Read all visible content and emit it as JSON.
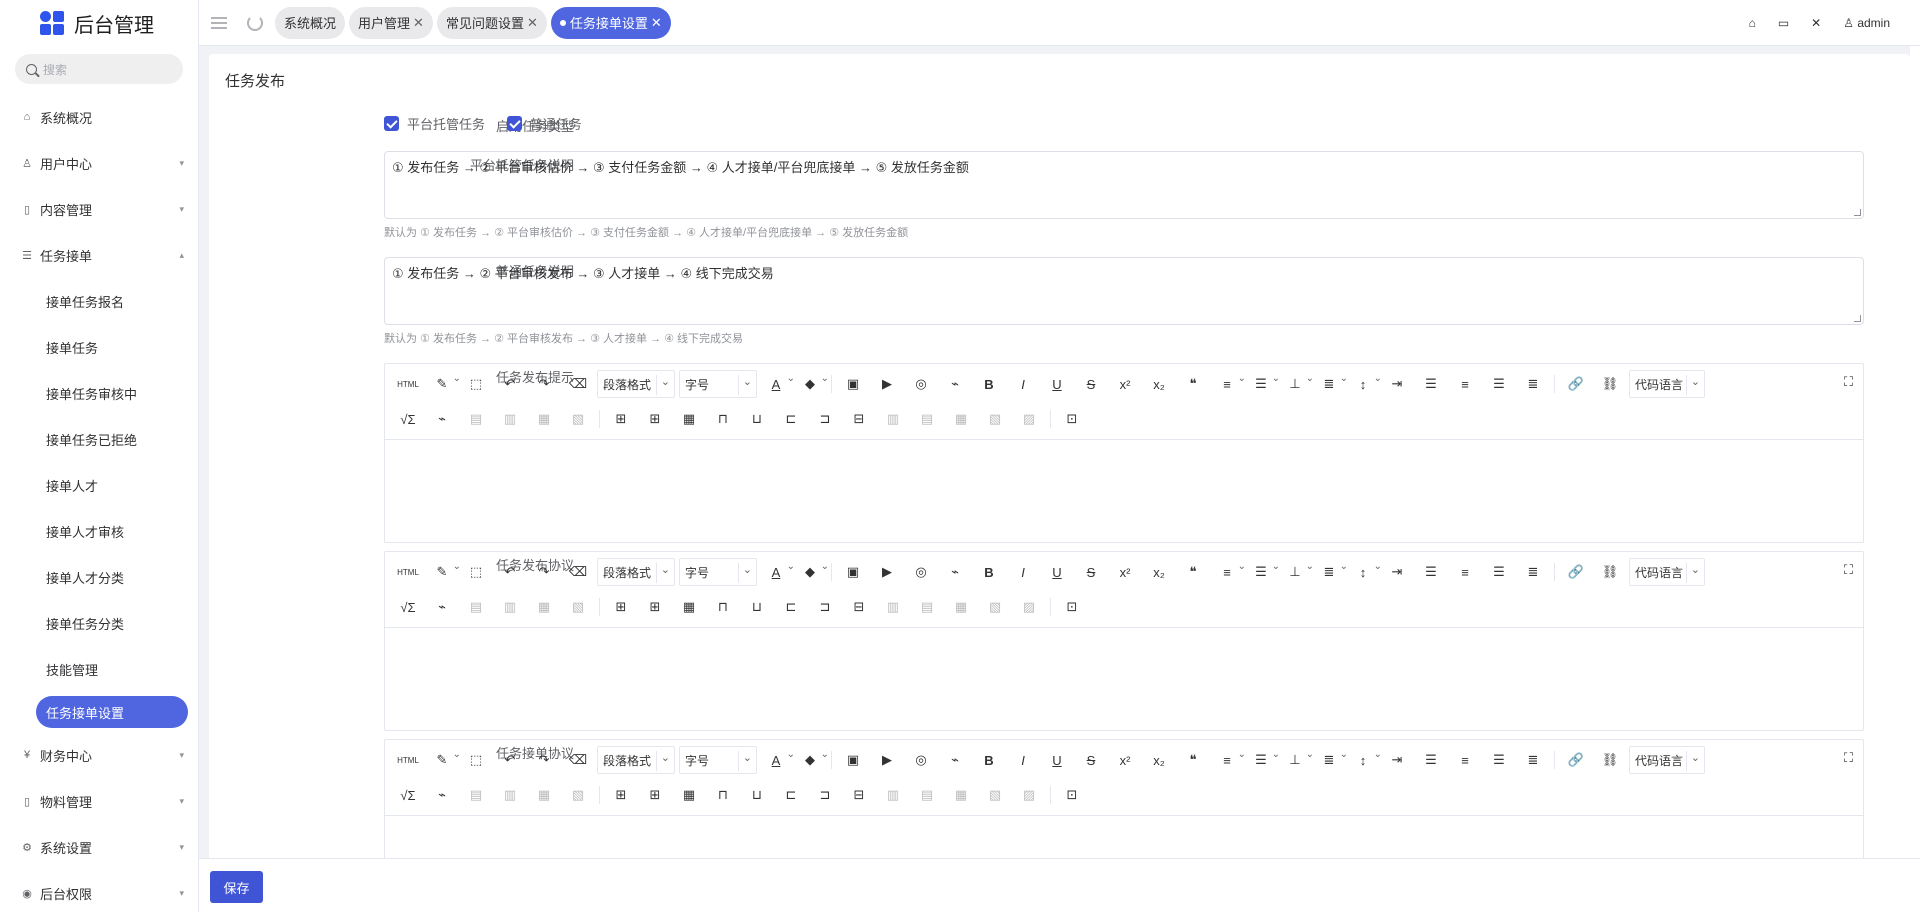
{
  "app": {
    "title": "后台管理"
  },
  "search": {
    "placeholder": "搜索"
  },
  "sidebar": {
    "items": [
      {
        "label": "系统概况",
        "icon": "home-icon"
      },
      {
        "label": "用户中心",
        "icon": "users-icon"
      },
      {
        "label": "内容管理",
        "icon": "document-icon"
      },
      {
        "label": "任务接单",
        "icon": "list-icon"
      },
      {
        "label": "财务中心",
        "icon": "yen-icon"
      },
      {
        "label": "物料管理",
        "icon": "document-icon"
      },
      {
        "label": "系统设置",
        "icon": "gear-icon"
      },
      {
        "label": "后台权限",
        "icon": "user-circle-icon"
      }
    ],
    "sub_items": [
      "接单任务报名",
      "接单任务",
      "接单任务审核中",
      "接单任务已拒绝",
      "接单人才",
      "接单人才审核",
      "接单人才分类",
      "接单任务分类",
      "技能管理",
      "任务接单设置"
    ]
  },
  "tabs": [
    {
      "label": "系统概况",
      "closable": false
    },
    {
      "label": "用户管理",
      "closable": true
    },
    {
      "label": "常见问题设置",
      "closable": true
    },
    {
      "label": "任务接单设置",
      "closable": true,
      "active": true
    }
  ],
  "header": {
    "user": "admin"
  },
  "main": {
    "title": "任务发布",
    "enable_label": "启用任务类型",
    "checkbox_platform": "平台托管任务",
    "checkbox_normal": "普通任务",
    "platform_desc_label": "平台托管任务说明",
    "platform_desc_value": "① 发布任务 → ② 平台审核估价 → ③ 支付任务金额 → ④ 人才接单/平台兜底接单 → ⑤ 发放任务金额",
    "platform_desc_hint": "默认为 ① 发布任务 → ② 平台审核估价 → ③ 支付任务金额 → ④ 人才接单/平台兜底接单 → ⑤ 发放任务金额",
    "normal_desc_label": "普通任务说明",
    "normal_desc_value": "① 发布任务 → ② 平台审核发布 → ③ 人才接单 → ④ 线下完成交易",
    "normal_desc_hint": "默认为 ① 发布任务 → ② 平台审核发布 → ③ 人才接单 → ④ 线下完成交易",
    "tips_label": "任务发布提示",
    "agreement_label": "任务发布协议",
    "order_agreement_label": "任务接单协议"
  },
  "editor": {
    "paragraph": "段落格式",
    "fontsize": "字号",
    "codelang": "代码语言"
  },
  "footer": {
    "save": "保存"
  },
  "colors": {
    "primary": "#3f55d5",
    "tab_active": "#4f66e0"
  }
}
